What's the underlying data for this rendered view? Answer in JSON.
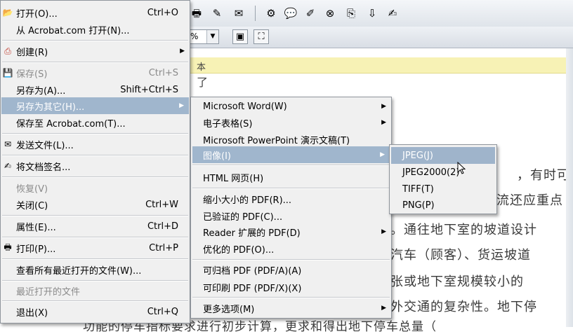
{
  "background": {
    "zoom_value": "%",
    "doc_highlight_text": "本",
    "doc_text_snippet": "了",
    "doc_lines": [
      "，有时可以",
      "流还应重点",
      "。通往地下室的坡道设计",
      "汽车（顾客）、货运坡道",
      "张或地下室规模较小的",
      "外交通的复杂性。地下停",
      "功能的停车指标要求进行初步计算，更求和得出地下停车总量（"
    ]
  },
  "main_menu": {
    "items": [
      {
        "label": "打开(O)...",
        "shortcut": "Ctrl+O",
        "icon": "open-folder-icon"
      },
      {
        "label": "从 Acrobat.com 打开(N)...",
        "shortcut": ""
      },
      {
        "label": "创建(R)",
        "shortcut": "",
        "icon": "create-pdf-icon"
      },
      {
        "label": "保存(S)",
        "shortcut": "Ctrl+S",
        "icon": "save-icon"
      },
      {
        "label": "另存为(A)...",
        "shortcut": "Shift+Ctrl+S"
      },
      {
        "label": "另存为其它(H)...",
        "shortcut": ""
      },
      {
        "label": "保存至 Acrobat.com(T)...",
        "shortcut": ""
      },
      {
        "label": "发送文件(L)...",
        "shortcut": "",
        "icon": "envelope-icon"
      },
      {
        "label": "将文档签名...",
        "shortcut": "",
        "icon": "sign-document-icon"
      },
      {
        "label": "恢复(V)",
        "shortcut": ""
      },
      {
        "label": "关闭(C)",
        "shortcut": "Ctrl+W"
      },
      {
        "label": "属性(E)...",
        "shortcut": "Ctrl+D"
      },
      {
        "label": "打印(P)...",
        "shortcut": "Ctrl+P",
        "icon": "printer-icon"
      },
      {
        "label": "查看所有最近打开的文件(W)...",
        "shortcut": ""
      },
      {
        "label": "最近打开的文件",
        "shortcut": ""
      },
      {
        "label": "退出(X)",
        "shortcut": "Ctrl+Q"
      }
    ]
  },
  "save_as_other_menu": {
    "items": [
      {
        "label": "Microsoft Word(W)"
      },
      {
        "label": "电子表格(S)"
      },
      {
        "label": "Microsoft PowerPoint 演示文稿(T)"
      },
      {
        "label": "图像(I)"
      },
      {
        "label": "HTML 网页(H)"
      },
      {
        "label": "缩小大小的 PDF(R)..."
      },
      {
        "label": "已验证的 PDF(C)..."
      },
      {
        "label": "Reader 扩展的 PDF(D)"
      },
      {
        "label": "优化的 PDF(O)..."
      },
      {
        "label": "可归档 PDF (PDF/A)(A)"
      },
      {
        "label": "可印刷 PDF (PDF/X)(X)"
      },
      {
        "label": "更多选项(M)"
      }
    ]
  },
  "image_menu": {
    "items": [
      {
        "label": "JPEG(J)"
      },
      {
        "label": "JPEG2000(2)"
      },
      {
        "label": "TIFF(T)"
      },
      {
        "label": "PNG(P)"
      }
    ]
  },
  "colors": {
    "menu_bg": "#f0f0f0",
    "highlight": "#a0b6cd",
    "disabled_text": "#8a8a8a",
    "doc_highlight": "#f7f2b5"
  }
}
